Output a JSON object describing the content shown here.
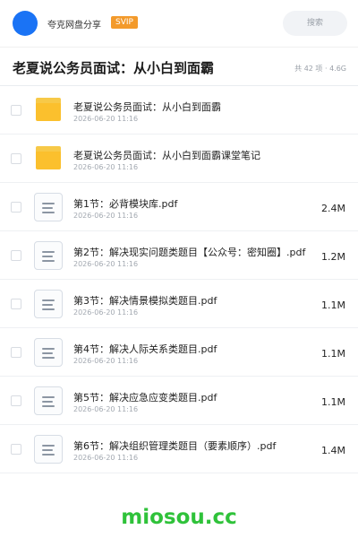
{
  "header": {
    "app_name": "夸克网盘分享",
    "badge": "SVIP",
    "search_placeholder": "搜索"
  },
  "title_bar": {
    "title": "老夏说公务员面试：从小白到面霸",
    "meta": "共 42 项 · 4.6G"
  },
  "files": [
    {
      "type": "folder",
      "name": "老夏说公务员面试：从小白到面霸",
      "date": "2026-06-20 11:16",
      "size": ""
    },
    {
      "type": "folder",
      "name": "老夏说公务员面试：从小白到面霸课堂笔记",
      "date": "2026-06-20 11:16",
      "size": ""
    },
    {
      "type": "doc",
      "name": "第1节：必背模块库.pdf",
      "date": "2026-06-20 11:16",
      "size": "2.4M"
    },
    {
      "type": "doc",
      "name": "第2节：解决现实问题类题目【公众号：密知圈】.pdf",
      "date": "2026-06-20 11:16",
      "size": "1.2M"
    },
    {
      "type": "doc",
      "name": "第3节：解决情景模拟类题目.pdf",
      "date": "2026-06-20 11:16",
      "size": "1.1M"
    },
    {
      "type": "doc",
      "name": "第4节：解决人际关系类题目.pdf",
      "date": "2026-06-20 11:16",
      "size": "1.1M"
    },
    {
      "type": "doc",
      "name": "第5节：解决应急应变类题目.pdf",
      "date": "2026-06-20 11:16",
      "size": "1.1M"
    },
    {
      "type": "doc",
      "name": "第6节：解决组织管理类题目（要素顺序）.pdf",
      "date": "2026-06-20 11:16",
      "size": "1.4M"
    }
  ],
  "watermark": "miosou.cc",
  "colors": {
    "accent": "#1a73f5",
    "badge": "#f39a2b",
    "folder": "#fbc02d",
    "watermark": "#2fc23a"
  }
}
